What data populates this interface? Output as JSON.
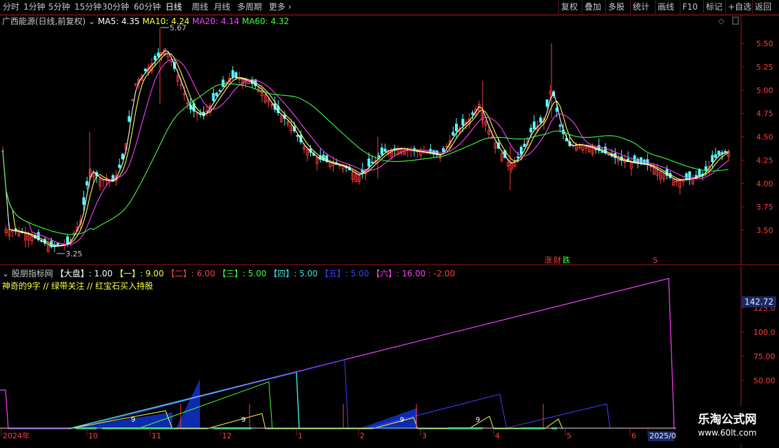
{
  "toolbar": {
    "left": [
      "分时",
      "1分钟",
      "5分钟",
      "15分钟",
      "30分钟",
      "60分钟",
      "日线",
      "周线",
      "月线",
      "多周期",
      "更多"
    ],
    "active": "日线",
    "right": [
      "复权",
      "叠加",
      "多股",
      "统计",
      "画线",
      "F10",
      "标记",
      "+自选",
      "返回"
    ]
  },
  "main": {
    "stock": "广西能源(日线,前复权)",
    "ma": [
      {
        "label": "MA5: 4.35",
        "color": "#ffffff"
      },
      {
        "label": "MA10: 4.24",
        "color": "#ffff40"
      },
      {
        "label": "MA20: 4.14",
        "color": "#ff40ff"
      },
      {
        "label": "MA60: 4.32",
        "color": "#40ff40"
      }
    ],
    "high_label": "5.67",
    "low_label": "3.25",
    "price_ticks": [
      "5.50",
      "5.25",
      "5.00",
      "4.75",
      "4.50",
      "4.25",
      "4.00",
      "3.75",
      "3.50"
    ],
    "markers": {
      "zhang": "涨",
      "cai": "财",
      "die": "跌",
      "s": "S"
    }
  },
  "sub": {
    "name": "股朋指标网",
    "params": [
      {
        "label": "【大盘】: 1.00",
        "color": "#ffffff"
      },
      {
        "label": "【一】: 9.00",
        "color": "#ffff40"
      },
      {
        "label": "【二】: 6.00",
        "color": "#ff4040"
      },
      {
        "label": "【三】: 5.00",
        "color": "#40ff40"
      },
      {
        "label": "【四】: 5.00",
        "color": "#40e0e0"
      },
      {
        "label": "【五】: 5.00",
        "color": "#4040ff"
      },
      {
        "label": "【六】: 16.00",
        "color": "#ff40ff"
      },
      {
        "label": ": -2.00",
        "color": "#ff4040"
      }
    ],
    "desc": "神奇的9字 // 绿带关注 // 红宝石买入持股",
    "current_value": "142.72",
    "ticks": [
      "125.0",
      "100.0",
      "75.00",
      "50.00"
    ],
    "nine_labels": [
      "9",
      "9",
      "9",
      "9"
    ]
  },
  "timeline": [
    "2024年",
    "10",
    "11",
    "12",
    "1",
    "2",
    "3",
    "4",
    "5",
    "6",
    "2025/0"
  ],
  "logo": {
    "title": "乐淘公式网",
    "url": "www.60lt.com"
  },
  "colors": {
    "up": "#ff3c3c",
    "down": "#54ffff",
    "axis": "#a01818"
  }
}
